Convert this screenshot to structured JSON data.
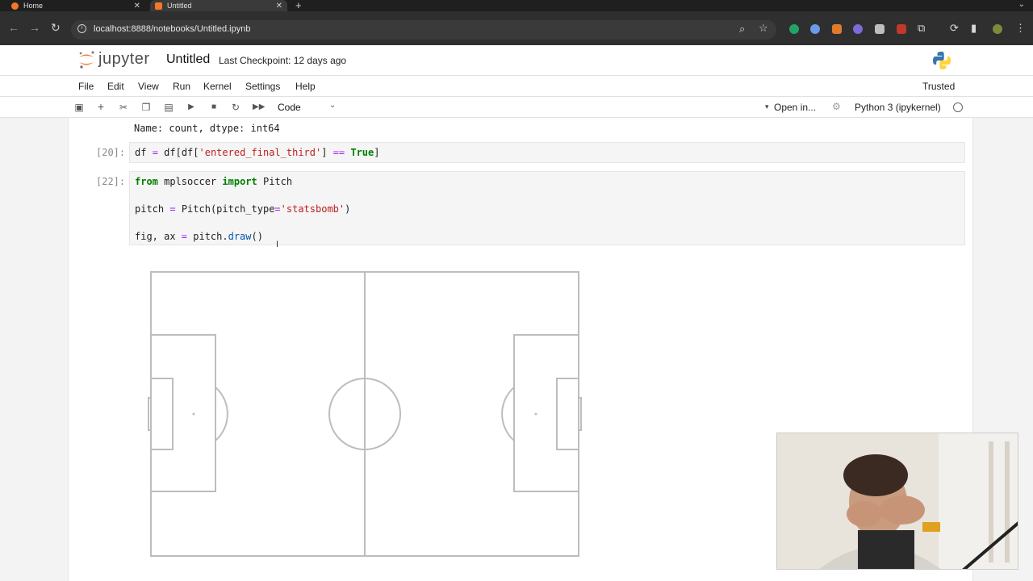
{
  "browser": {
    "tabs": [
      {
        "label": "Home",
        "active": false
      },
      {
        "label": "Untitled",
        "active": true
      }
    ],
    "url": "localhost:8888/notebooks/Untitled.ipynb"
  },
  "jupyter": {
    "logo_text": "jupyter",
    "notebook_title": "Untitled",
    "checkpoint": "Last Checkpoint: 12 days ago",
    "menu": [
      "File",
      "Edit",
      "View",
      "Run",
      "Kernel",
      "Settings",
      "Help"
    ],
    "trusted": "Trusted",
    "cell_type": "Code",
    "open_in": "Open in...",
    "kernel_name": "Python 3 (ipykernel)"
  },
  "cells": {
    "output_line": "Name: count, dtype: int64",
    "cell20_prompt": "[20]:",
    "cell22_prompt": "[22]:"
  },
  "colors": {
    "accent_orange": "#f37726",
    "keyword_green": "#008000",
    "string_red": "#ba2121"
  }
}
